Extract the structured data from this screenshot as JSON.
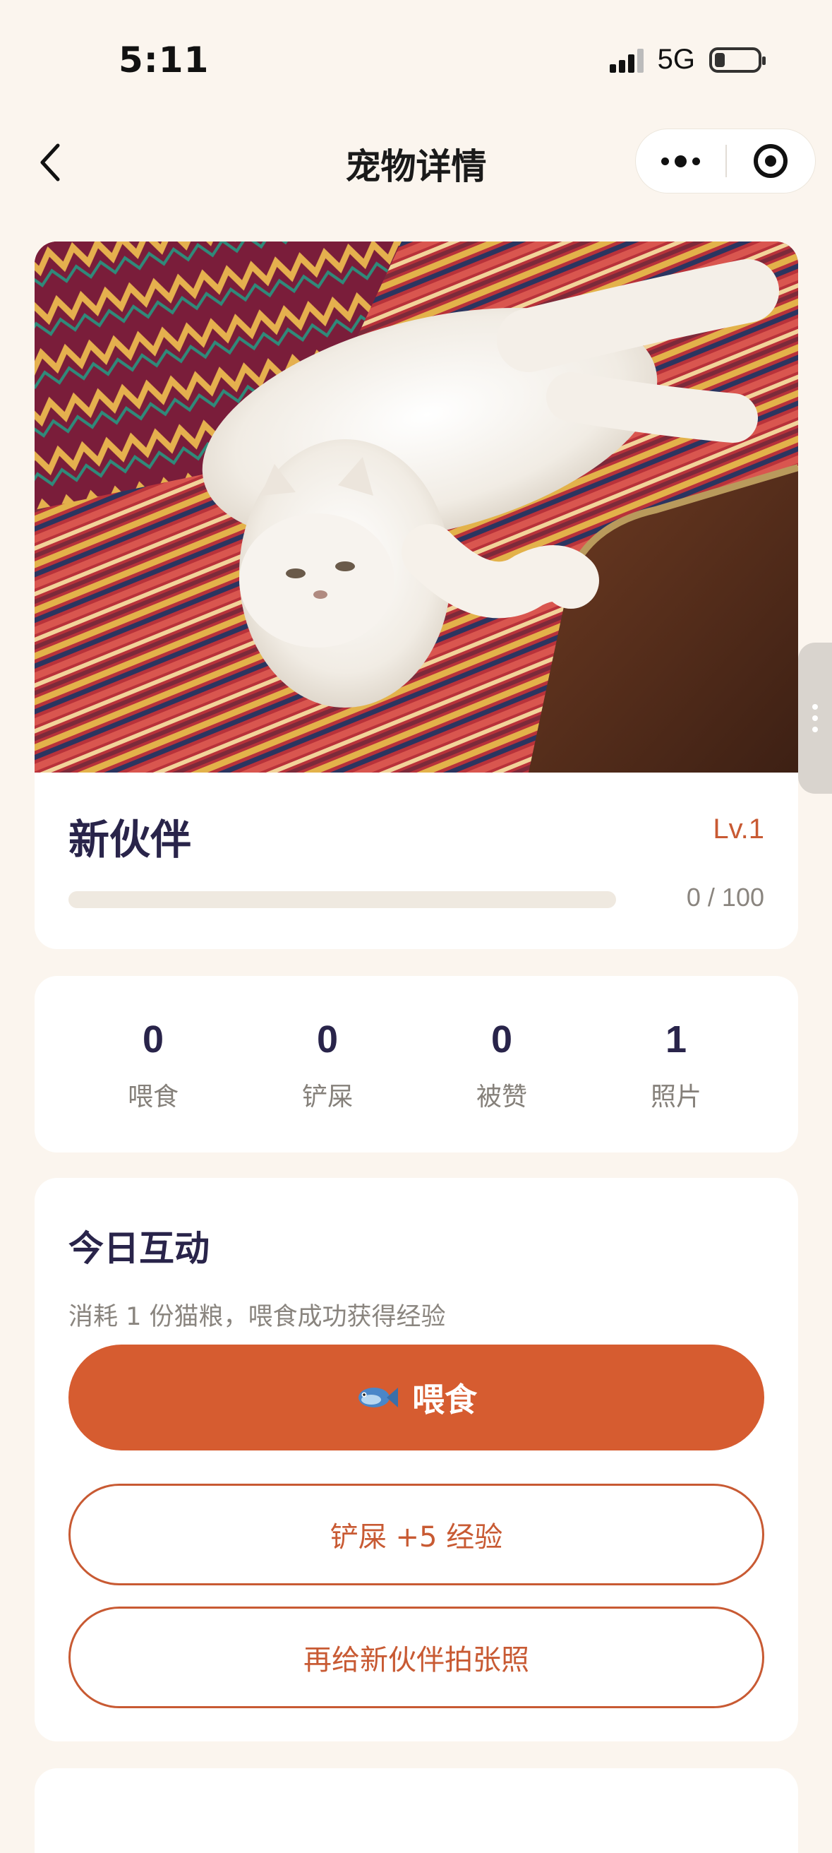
{
  "status_bar": {
    "time": "5:11",
    "network": "5G"
  },
  "nav": {
    "title": "宠物详情",
    "back_icon": "chevron-left-icon",
    "more_icon": "more-dots-icon",
    "close_icon": "target-circle-icon"
  },
  "pet": {
    "photo_alt": "cat-photo",
    "name": "新伙伴",
    "level": "Lv.1",
    "xp_text": "0 / 100",
    "xp_progress": 0
  },
  "stats": [
    {
      "value": "0",
      "label": "喂食"
    },
    {
      "value": "0",
      "label": "铲屎"
    },
    {
      "value": "0",
      "label": "被赞"
    },
    {
      "value": "1",
      "label": "照片"
    }
  ],
  "interaction": {
    "title": "今日互动",
    "hint": "消耗 1 份猫粮，喂食成功获得经验",
    "feed_icon": "fish-icon",
    "feed_label": "喂食",
    "scoop_label": "铲屎 +5 经验",
    "photo_label": "再给新伙伴拍张照"
  },
  "colors": {
    "accent": "#d65c30",
    "accent_text": "#c85a33",
    "background": "#fbf5ee",
    "heading": "#29244a"
  }
}
